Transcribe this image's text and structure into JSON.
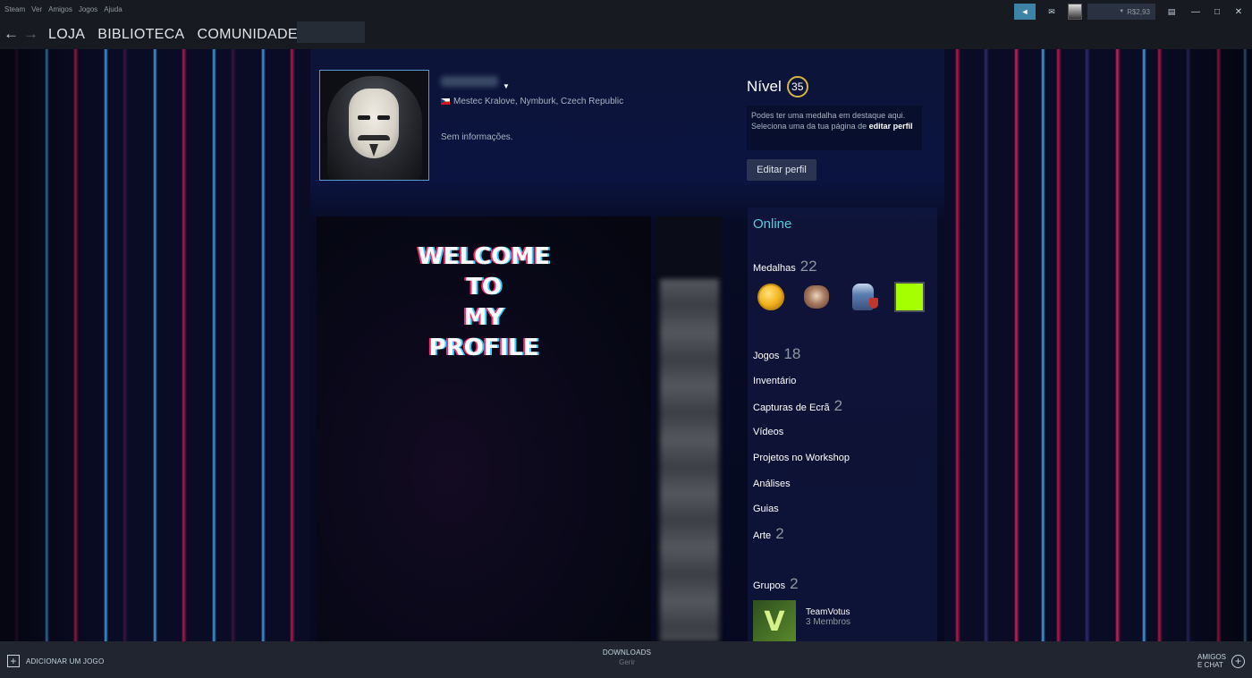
{
  "menu": {
    "items": [
      "Steam",
      "Ver",
      "Amigos",
      "Jogos",
      "Ajuda"
    ]
  },
  "account": {
    "wallet": "R$2,93"
  },
  "nav": {
    "links": [
      "LOJA",
      "BIBLIOTECA",
      "COMUNIDADE"
    ]
  },
  "profile": {
    "location": "Mestec Kralove, Nymburk, Czech Republic",
    "summary": "Sem informações.",
    "level_label": "Nível",
    "level": "35",
    "showcase_note_text": "Podes ter uma medalha em destaque aqui. Seleciona uma da tua página de",
    "showcase_note_link": "editar perfil",
    "edit_button": "Editar perfil"
  },
  "artwork": {
    "welcome_lines": [
      "WELCOME",
      "TO",
      "MY",
      "PROFILE"
    ]
  },
  "stats": {
    "status": "Online",
    "badges_label": "Medalhas",
    "badges_count": "22",
    "games_label": "Jogos",
    "games_count": "18",
    "inventory_label": "Inventário",
    "screenshots_label": "Capturas de Ecrã",
    "screenshots_count": "2",
    "videos_label": "Vídeos",
    "workshop_label": "Projetos no Workshop",
    "reviews_label": "Análises",
    "guides_label": "Guias",
    "art_label": "Arte",
    "art_count": "2",
    "groups_label": "Grupos",
    "groups_count": "2",
    "group": {
      "name": "TeamVotus",
      "members": "3 Membros",
      "logo_letter": "V"
    }
  },
  "bottom": {
    "add_game": "ADICIONAR UM JOGO",
    "downloads": "DOWNLOADS",
    "downloads_sub": "Gerir",
    "friends_line1": "AMIGOS",
    "friends_line2": "E CHAT"
  },
  "colors": {
    "accent_blue": "#57cbde",
    "level_ring": "#d8b541",
    "badge_green": "#a6ff00"
  },
  "icons": [
    "back-arrow-icon",
    "forward-arrow-icon",
    "announcement-icon",
    "notifications-icon",
    "big-picture-icon",
    "minimize-icon",
    "maximize-icon",
    "close-icon",
    "plus-icon",
    "plus-circle-icon",
    "czech-flag-icon",
    "dropdown-caret-icon"
  ]
}
